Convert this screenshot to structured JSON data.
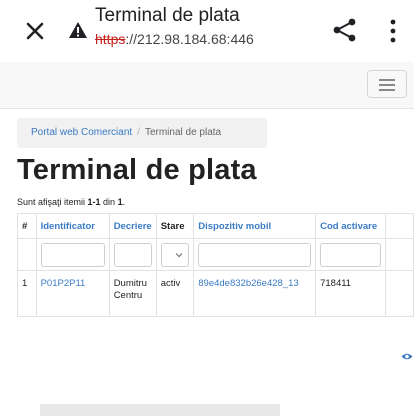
{
  "browser": {
    "title": "Terminal de plata",
    "url_scheme": "https",
    "url_rest": "://212.98.184.68:446",
    "close_icon": "close-icon",
    "warning_icon": "warning-icon",
    "share_icon": "share-icon",
    "menu_icon": "more-vert-icon"
  },
  "breadcrumb": {
    "home": "Portal web Comerciant",
    "separator": "/",
    "current": "Terminal de plata"
  },
  "page": {
    "title": "Terminal de plata",
    "summary_prefix": "Sunt afişaţi itemii ",
    "summary_range": "1-1",
    "summary_mid": " din ",
    "summary_total": "1",
    "summary_end": "."
  },
  "table": {
    "headers": [
      "#",
      "Identificator",
      "Decriere",
      "Stare",
      "Dispozitiv mobil",
      "Cod activare"
    ],
    "rows": [
      {
        "index": "1",
        "identificator": "P01P2P11",
        "descriere": "Dumitru Centru",
        "stare": "activ",
        "dispozitiv": "89e4de832b26e428_13",
        "cod": "718411",
        "action_icon": "eye-icon"
      }
    ]
  },
  "colors": {
    "link": "#3a7bc4",
    "insecure_scheme": "#c5221f"
  }
}
